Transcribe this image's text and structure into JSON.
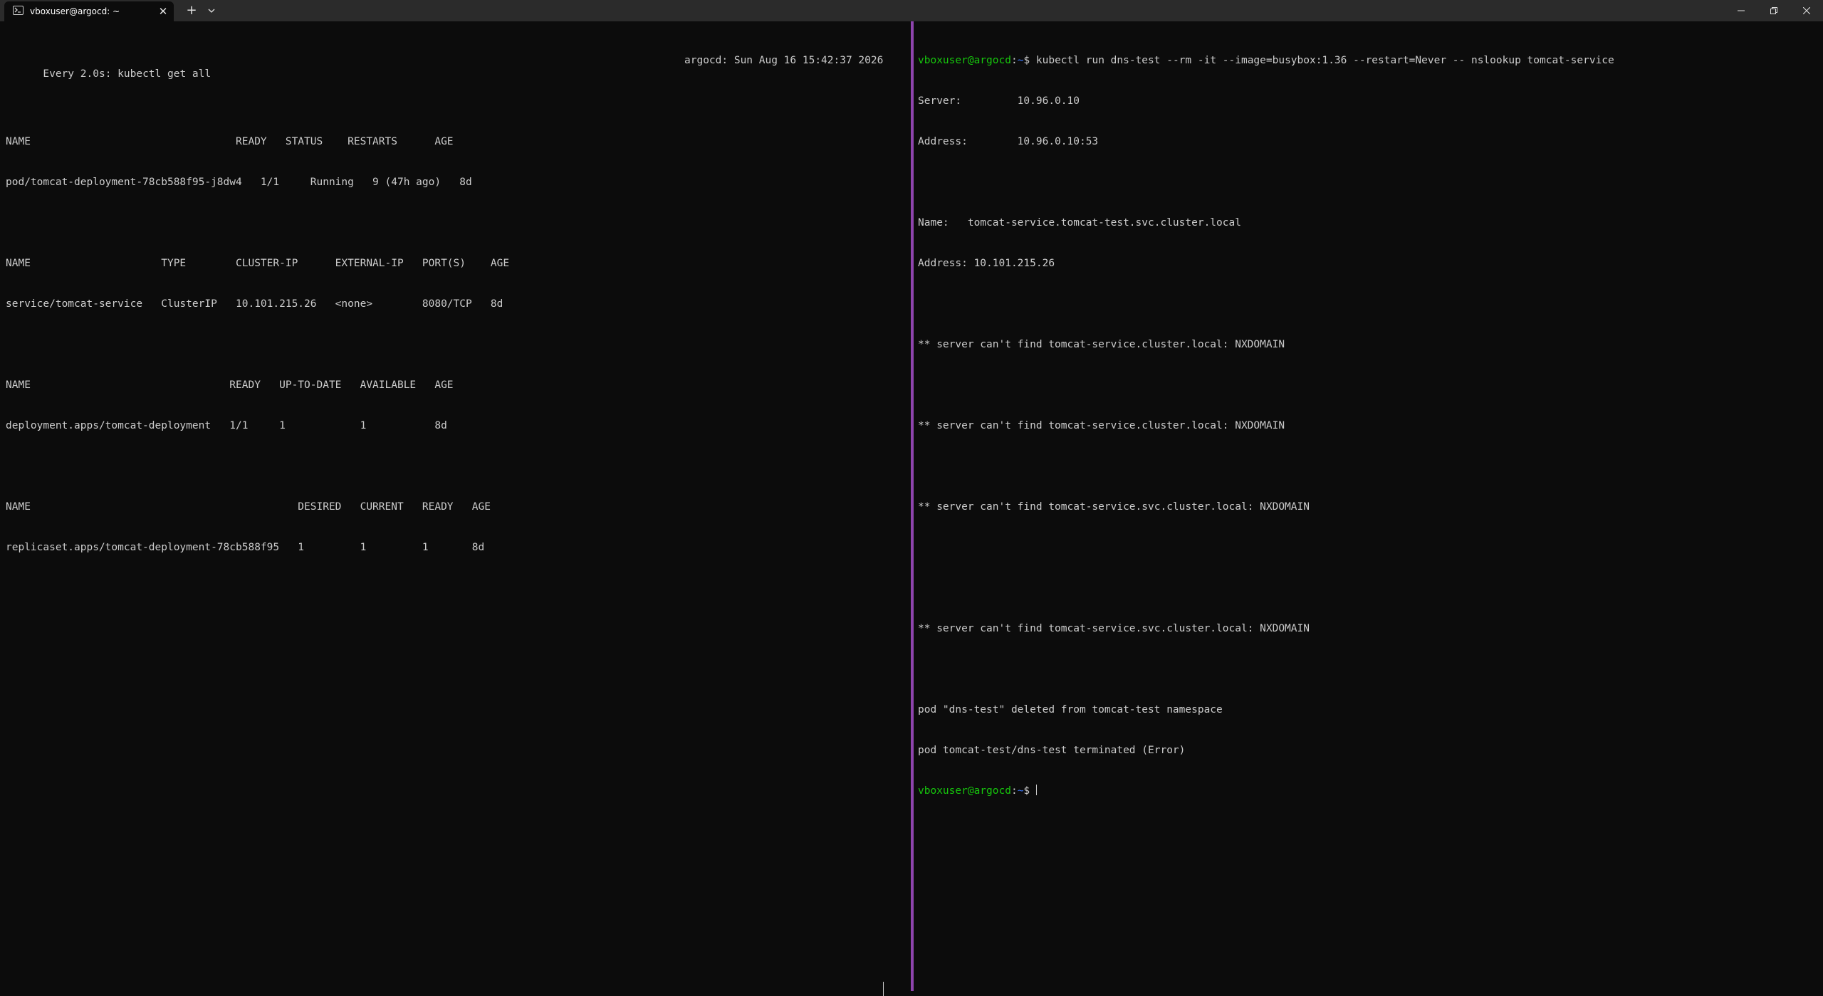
{
  "window": {
    "tab_title": "vboxuser@argocd: ~",
    "close_glyph": "✕",
    "new_tab_glyph": "+"
  },
  "left_pane": {
    "header_left": "Every 2.0s: kubectl get all",
    "header_right": "argocd: Sun Aug 16 15:42:37 2026",
    "lines": [
      "",
      "NAME                                 READY   STATUS    RESTARTS      AGE",
      "pod/tomcat-deployment-78cb588f95-j8dw4   1/1     Running   9 (47h ago)   8d",
      "",
      "NAME                     TYPE        CLUSTER-IP      EXTERNAL-IP   PORT(S)    AGE",
      "service/tomcat-service   ClusterIP   10.101.215.26   <none>        8080/TCP   8d",
      "",
      "NAME                                READY   UP-TO-DATE   AVAILABLE   AGE",
      "deployment.apps/tomcat-deployment   1/1     1            1           8d",
      "",
      "NAME                                           DESIRED   CURRENT   READY   AGE",
      "replicaset.apps/tomcat-deployment-78cb588f95   1         1         1       8d"
    ]
  },
  "right_pane": {
    "prompt_user_host": "vboxuser@argocd",
    "prompt_sep": ":",
    "prompt_path": "~",
    "prompt_symbol": "$ ",
    "command": "kubectl run dns-test --rm -it --image=busybox:1.36 --restart=Never -- nslookup tomcat-service",
    "output": [
      "Server:         10.96.0.10",
      "Address:        10.96.0.10:53",
      "",
      "Name:   tomcat-service.tomcat-test.svc.cluster.local",
      "Address: 10.101.215.26",
      "",
      "** server can't find tomcat-service.cluster.local: NXDOMAIN",
      "",
      "** server can't find tomcat-service.cluster.local: NXDOMAIN",
      "",
      "** server can't find tomcat-service.svc.cluster.local: NXDOMAIN",
      "",
      "",
      "** server can't find tomcat-service.svc.cluster.local: NXDOMAIN",
      "",
      "pod \"dns-test\" deleted from tomcat-test namespace",
      "pod tomcat-test/dns-test terminated (Error)"
    ]
  },
  "colors": {
    "background": "#0c0c0c",
    "titlebar": "#2b2b2b",
    "text": "#cccccc",
    "prompt_green": "#16c60c",
    "prompt_blue": "#3b78ff",
    "pane_divider": "#8e44ad"
  },
  "icons": {
    "tab": "terminal-icon",
    "close": "close-icon",
    "new_tab": "plus-icon",
    "dropdown": "chevron-down-icon",
    "minimize": "minimize-icon",
    "maximize": "restore-icon",
    "window_close": "close-icon"
  }
}
